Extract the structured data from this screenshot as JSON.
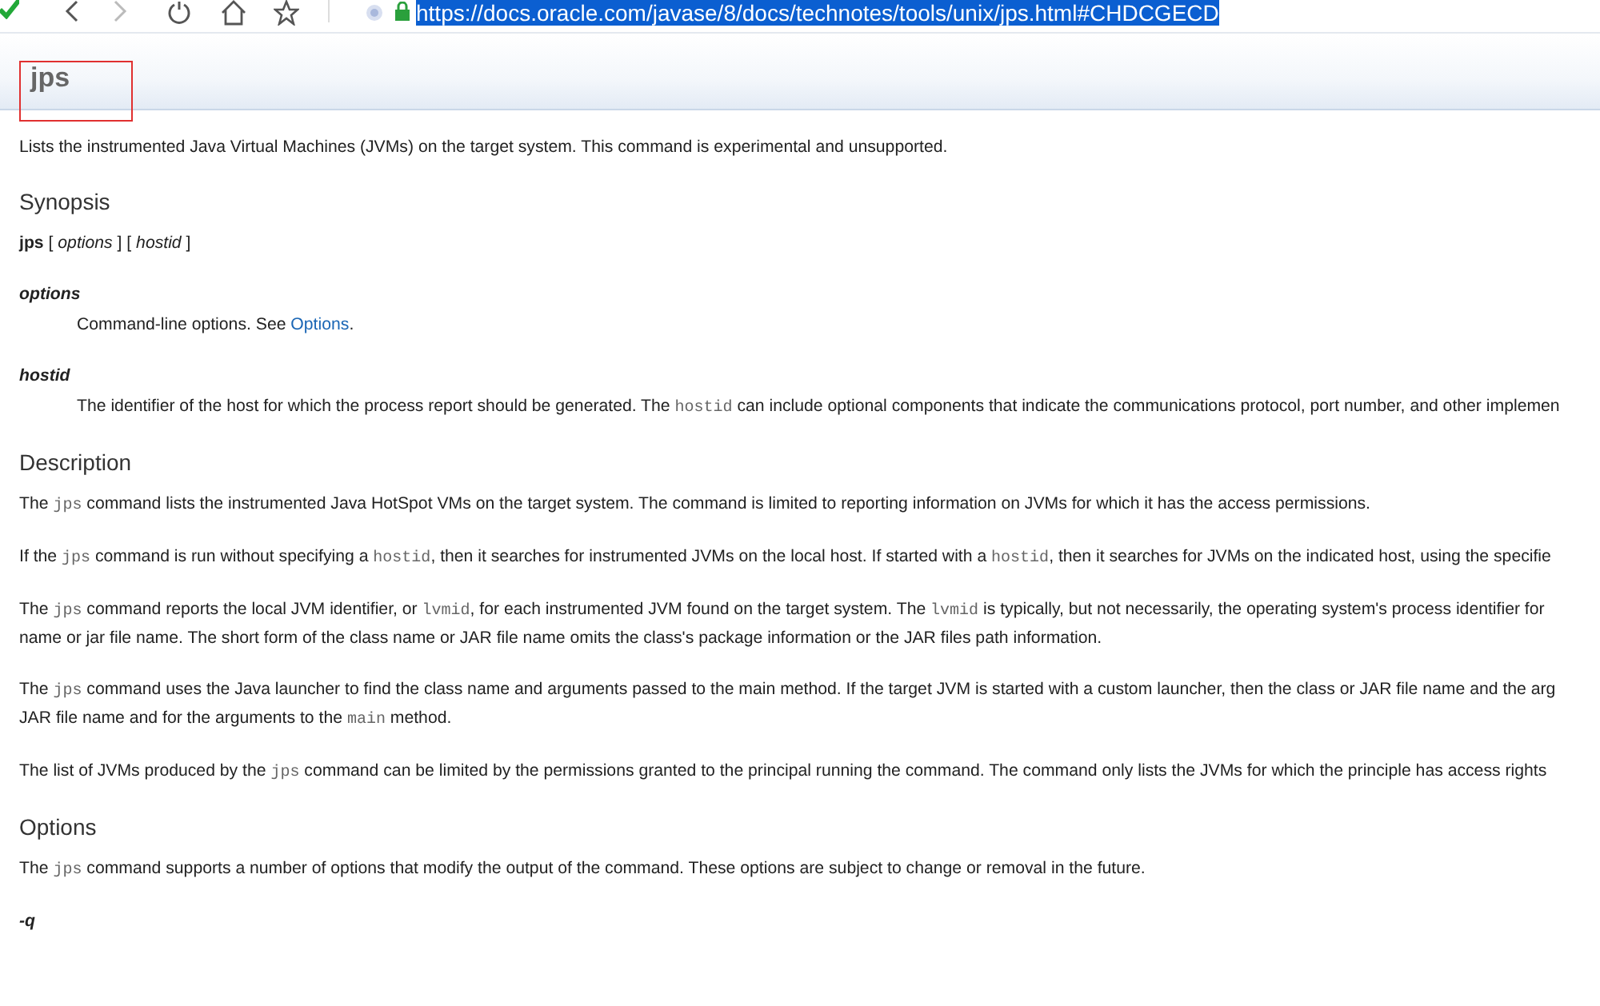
{
  "browser": {
    "url": "https://docs.oracle.com/javase/8/docs/technotes/tools/unix/jps.html#CHDCGECD",
    "url_selected": true,
    "forward_disabled": true
  },
  "page": {
    "title": "jps",
    "title_marked": true,
    "intro": "Lists the instrumented Java Virtual Machines (JVMs) on the target system. This command is experimental and unsupported.",
    "sections": [
      {
        "heading": "Synopsis",
        "blocks": [
          {
            "kind": "para",
            "lines": [
              [
                {
                  "text": "jps",
                  "kind": "bold"
                },
                {
                  "text": " [ ",
                  "kind": "plain"
                },
                {
                  "text": "options",
                  "kind": "italic"
                },
                {
                  "text": " ] [ ",
                  "kind": "plain"
                },
                {
                  "text": "hostid",
                  "kind": "italic"
                },
                {
                  "text": " ]",
                  "kind": "plain"
                }
              ]
            ]
          },
          {
            "kind": "term",
            "term": "options",
            "lines": [
              [
                {
                  "text": "Command-line options. See ",
                  "kind": "plain"
                },
                {
                  "text": "Options",
                  "kind": "link"
                },
                {
                  "text": ".",
                  "kind": "plain"
                }
              ]
            ]
          },
          {
            "kind": "term",
            "term": "hostid",
            "lines": [
              [
                {
                  "text": "The identifier of the host for which the process report should be generated. The ",
                  "kind": "plain"
                },
                {
                  "text": "hostid",
                  "kind": "code"
                },
                {
                  "text": " can include optional components that indicate the communications protocol, port number, and other implemen",
                  "kind": "plain"
                }
              ]
            ]
          }
        ]
      },
      {
        "heading": "Description",
        "blocks": [
          {
            "kind": "para",
            "lines": [
              [
                {
                  "text": "The ",
                  "kind": "plain"
                },
                {
                  "text": "jps",
                  "kind": "code"
                },
                {
                  "text": " command lists the instrumented Java HotSpot VMs on the target system. The command is limited to reporting information on JVMs for which it has the access permissions.",
                  "kind": "plain"
                }
              ]
            ]
          },
          {
            "kind": "para",
            "lines": [
              [
                {
                  "text": "If the ",
                  "kind": "plain"
                },
                {
                  "text": "jps",
                  "kind": "code"
                },
                {
                  "text": " command is run without specifying a ",
                  "kind": "plain"
                },
                {
                  "text": "hostid",
                  "kind": "code"
                },
                {
                  "text": ", then it searches for instrumented JVMs on the local host. If started with a ",
                  "kind": "plain"
                },
                {
                  "text": "hostid",
                  "kind": "code"
                },
                {
                  "text": ", then it searches for JVMs on the indicated host, using the specifie",
                  "kind": "plain"
                }
              ]
            ]
          },
          {
            "kind": "para",
            "lines": [
              [
                {
                  "text": "The ",
                  "kind": "plain"
                },
                {
                  "text": "jps",
                  "kind": "code"
                },
                {
                  "text": " command reports the local JVM identifier, or ",
                  "kind": "plain"
                },
                {
                  "text": "lvmid",
                  "kind": "code"
                },
                {
                  "text": ", for each instrumented JVM found on the target system. The ",
                  "kind": "plain"
                },
                {
                  "text": "lvmid",
                  "kind": "code"
                },
                {
                  "text": " is typically, but not necessarily, the operating system's process identifier for",
                  "kind": "plain"
                }
              ],
              [
                {
                  "text": "name or jar file name. The short form of the class name or JAR file name omits the class's package information or the JAR files path information.",
                  "kind": "plain"
                }
              ]
            ]
          },
          {
            "kind": "para",
            "lines": [
              [
                {
                  "text": "The ",
                  "kind": "plain"
                },
                {
                  "text": "jps",
                  "kind": "code"
                },
                {
                  "text": " command uses the Java launcher to find the class name and arguments passed to the main method. If the target JVM is started with a custom launcher, then the class or JAR file name and the arg",
                  "kind": "plain"
                }
              ],
              [
                {
                  "text": "JAR file name and for the arguments to the ",
                  "kind": "plain"
                },
                {
                  "text": "main",
                  "kind": "code"
                },
                {
                  "text": " method.",
                  "kind": "plain"
                }
              ]
            ]
          },
          {
            "kind": "para",
            "lines": [
              [
                {
                  "text": "The list of JVMs produced by the ",
                  "kind": "plain"
                },
                {
                  "text": "jps",
                  "kind": "code"
                },
                {
                  "text": " command can be limited by the permissions granted to the principal running the command. The command only lists the JVMs for which the principle has access rights",
                  "kind": "plain"
                }
              ]
            ]
          }
        ]
      },
      {
        "heading": "Options",
        "blocks": [
          {
            "kind": "para",
            "lines": [
              [
                {
                  "text": "The ",
                  "kind": "plain"
                },
                {
                  "text": "jps",
                  "kind": "code"
                },
                {
                  "text": " command supports a number of options that modify the output of the command. These options are subject to change or removal in the future.",
                  "kind": "plain"
                }
              ]
            ]
          },
          {
            "kind": "term",
            "term": "-q"
          }
        ]
      }
    ]
  }
}
